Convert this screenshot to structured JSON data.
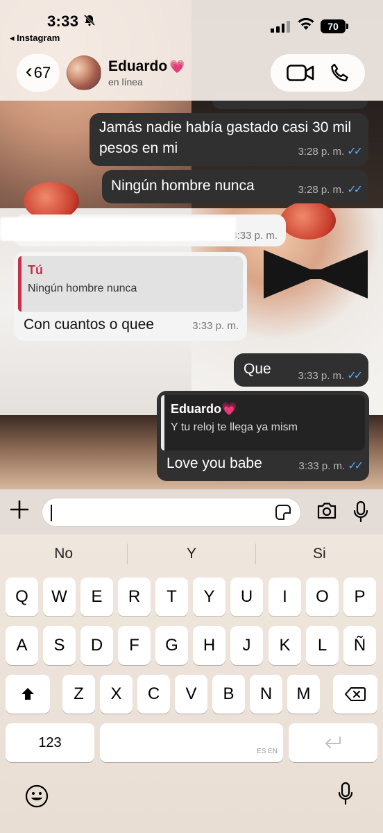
{
  "status_bar": {
    "time": "3:33",
    "back_app": "◂ Instagram",
    "battery": "70"
  },
  "header": {
    "back_count": "67",
    "contact_name": "Eduardo",
    "contact_emoji": "💗",
    "contact_status": "en línea"
  },
  "messages": [
    {
      "text": "Jamás nadie había gastado casi 30 mil pesos en mi",
      "time": "3:28 p. m.",
      "direction": "out",
      "read": true
    },
    {
      "text": "Ningún hombre nunca",
      "time": "3:28 p. m.",
      "direction": "out",
      "read": true
    },
    {
      "text": "",
      "time": "3:33 p. m.",
      "direction": "in",
      "redacted": true
    },
    {
      "quote_author": "Tú",
      "quote_text": "Ningún hombre nunca",
      "text": "Con cuantos o quee",
      "time": "3:33 p. m.",
      "direction": "in"
    },
    {
      "text": "Que",
      "time": "3:33 p. m.",
      "direction": "out",
      "read": true
    },
    {
      "quote_author": "Eduardo💗",
      "quote_text": "Y tu reloj te llega ya mism",
      "text": "Love you babe",
      "time": "3:33 p. m.",
      "direction": "out",
      "read": true
    }
  ],
  "input": {
    "value": ""
  },
  "keyboard": {
    "suggestions": [
      "No",
      "Y",
      "Si"
    ],
    "row1": [
      "Q",
      "W",
      "E",
      "R",
      "T",
      "Y",
      "U",
      "I",
      "O",
      "P"
    ],
    "row2": [
      "A",
      "S",
      "D",
      "F",
      "G",
      "H",
      "J",
      "K",
      "L",
      "Ñ"
    ],
    "row3": [
      "Z",
      "X",
      "C",
      "V",
      "B",
      "N",
      "M"
    ],
    "numbers_key": "123",
    "space_lang": "ES EN"
  },
  "colors": {
    "outgoing_bubble": "#303030",
    "incoming_bubble": "#f4f4f4",
    "read_ticks": "#5aa8ff",
    "quote_bar_in": "#c4314b"
  },
  "icons": [
    "bell-slash-icon",
    "signal-icon",
    "wifi-icon",
    "chevron-left-icon",
    "video-icon",
    "phone-icon",
    "plus-icon",
    "sticker-icon",
    "camera-icon",
    "microphone-icon",
    "shift-icon",
    "backspace-icon",
    "return-icon",
    "emoji-icon",
    "dictation-icon"
  ]
}
